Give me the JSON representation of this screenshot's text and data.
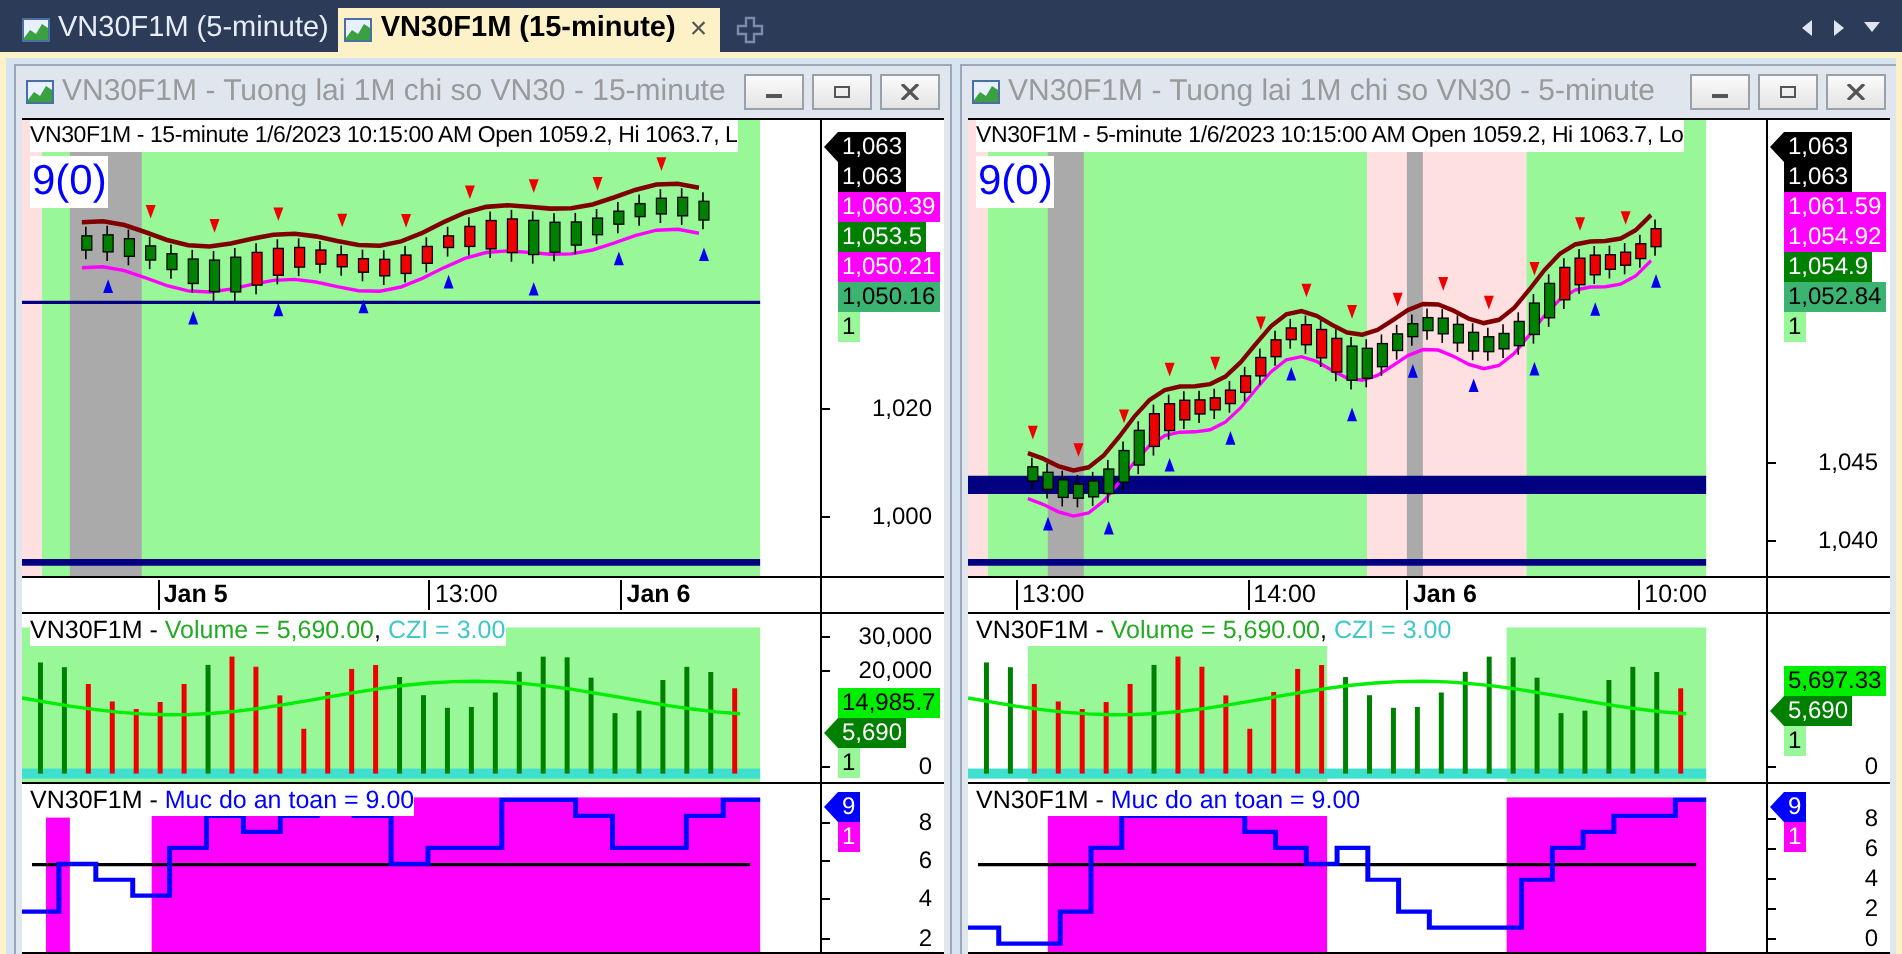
{
  "tabs": [
    {
      "label": "VN30F1M (5-minute)",
      "selected": false
    },
    {
      "label": "VN30F1M (15-minute)",
      "selected": true,
      "close": "×"
    }
  ],
  "windows": [
    {
      "title": "VN30F1M - Tuong lai 1M chi so VN30 - 15-minute",
      "price": {
        "header": "VN30F1M - 15-minute 1/6/2023 10:15:00 AM Open 1059.2, Hi 1063.7, L",
        "signal": "9(0)",
        "ticks": [
          "1,020",
          "1,000"
        ],
        "badges": [
          {
            "text": "1,063",
            "color": "#000000",
            "kind": "pointer"
          },
          {
            "text": "1,063",
            "color": "#000000",
            "kind": "plain"
          },
          {
            "text": "1,060.39",
            "color": "#ff00ff",
            "kind": "plain"
          },
          {
            "text": "1,053.5",
            "color": "#008000",
            "kind": "plain"
          },
          {
            "text": "1,050.21",
            "color": "#ff00ff",
            "kind": "plain"
          },
          {
            "text": "1,050.16",
            "color": "#3cb371",
            "kind": "plain"
          },
          {
            "text": "1",
            "color": "#98f898",
            "kind": "plain"
          }
        ]
      },
      "xaxis": [
        {
          "label": "Jan 5",
          "kind": "date"
        },
        {
          "label": "13:00",
          "kind": "time"
        },
        {
          "label": "Jan 6",
          "kind": "date"
        }
      ],
      "volume": {
        "header": [
          {
            "text": "VN30F1M - ",
            "color": "#000000"
          },
          {
            "text": "Volume = 5,690.00",
            "color": "#22aa22"
          },
          {
            "text": ", ",
            "color": "#000000"
          },
          {
            "text": "CZI = 3.00",
            "color": "#40c8c8"
          }
        ],
        "ticks": [
          "30,000",
          "20,000",
          "0"
        ],
        "badges": [
          {
            "text": "14,985.7",
            "color": "#00ee00",
            "kind": "plain"
          },
          {
            "text": "5,690",
            "color": "#008000",
            "kind": "pointer"
          },
          {
            "text": "1",
            "color": "#98f898",
            "kind": "plain"
          }
        ]
      },
      "safety": {
        "header": [
          {
            "text": "VN30F1M - ",
            "color": "#000000"
          },
          {
            "text": "Muc do an toan = 9.00",
            "color": "#0000ff"
          }
        ],
        "ticks": [
          "8",
          "6",
          "4",
          "2"
        ],
        "badges": [
          {
            "text": "9",
            "color": "#0000ff",
            "kind": "pointer"
          },
          {
            "text": "1",
            "color": "#ff00ff",
            "kind": "plain"
          }
        ]
      }
    },
    {
      "title": "VN30F1M - Tuong lai 1M chi so VN30 - 5-minute",
      "price": {
        "header": "VN30F1M - 5-minute 1/6/2023 10:15:00 AM Open 1059.2, Hi 1063.7, Lo",
        "signal": "9(0)",
        "ticks": [
          "1,045",
          "1,040"
        ],
        "badges": [
          {
            "text": "1,063",
            "color": "#000000",
            "kind": "pointer"
          },
          {
            "text": "1,063",
            "color": "#000000",
            "kind": "plain"
          },
          {
            "text": "1,061.59",
            "color": "#ff00ff",
            "kind": "plain"
          },
          {
            "text": "1,054.92",
            "color": "#ff00ff",
            "kind": "plain"
          },
          {
            "text": "1,054.9",
            "color": "#008000",
            "kind": "plain"
          },
          {
            "text": "1,052.84",
            "color": "#3cb371",
            "kind": "plain"
          },
          {
            "text": "1",
            "color": "#98f898",
            "kind": "plain"
          }
        ]
      },
      "xaxis": [
        {
          "label": "13:00",
          "kind": "time"
        },
        {
          "label": "14:00",
          "kind": "time"
        },
        {
          "label": "Jan 6",
          "kind": "date"
        },
        {
          "label": "10:00",
          "kind": "time"
        }
      ],
      "volume": {
        "header": [
          {
            "text": "VN30F1M - ",
            "color": "#000000"
          },
          {
            "text": "Volume = 5,690.00",
            "color": "#22aa22"
          },
          {
            "text": ", ",
            "color": "#000000"
          },
          {
            "text": "CZI = 3.00",
            "color": "#40c8c8"
          }
        ],
        "ticks": [
          "0"
        ],
        "badges": [
          {
            "text": "5,697.33",
            "color": "#00ee00",
            "kind": "plain"
          },
          {
            "text": "5,690",
            "color": "#008000",
            "kind": "pointer"
          },
          {
            "text": "1",
            "color": "#98f898",
            "kind": "plain"
          }
        ]
      },
      "safety": {
        "header": [
          {
            "text": "VN30F1M - ",
            "color": "#000000"
          },
          {
            "text": "Muc do an toan = 9.00",
            "color": "#0000ff"
          }
        ],
        "ticks": [
          "8",
          "6",
          "4",
          "2",
          "0"
        ],
        "badges": [
          {
            "text": "9",
            "color": "#0000ff",
            "kind": "pointer"
          },
          {
            "text": "1",
            "color": "#ff00ff",
            "kind": "plain"
          }
        ]
      }
    }
  ]
}
